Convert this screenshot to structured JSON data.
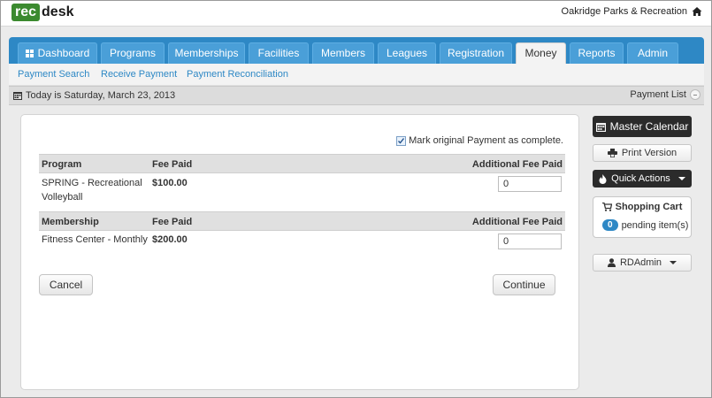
{
  "header": {
    "logo_left": "rec",
    "logo_right": "desk",
    "org_name": "Oakridge Parks & Recreation"
  },
  "nav": {
    "tabs": [
      "Dashboard",
      "Programs",
      "Memberships",
      "Facilities",
      "Members",
      "Leagues",
      "Registration",
      "Money",
      "Reports",
      "Admin"
    ],
    "active": "Money"
  },
  "subnav": {
    "links": [
      "Payment Search",
      "Receive Payment",
      "Payment Reconciliation"
    ]
  },
  "datebar": {
    "today": "Today is Saturday, March 23, 2013",
    "payment_list": "Payment List"
  },
  "form": {
    "mark_complete_label": "Mark original Payment as complete.",
    "mark_complete_checked": true,
    "program_table": {
      "headers": [
        "Program",
        "Fee Paid",
        "Additional Fee Paid"
      ],
      "rows": [
        {
          "name_line1": "SPRING - Recreational",
          "name_line2": "Volleyball",
          "fee": "$100.00",
          "additional": "0"
        }
      ]
    },
    "membership_table": {
      "headers": [
        "Membership",
        "Fee Paid",
        "Additional Fee Paid"
      ],
      "rows": [
        {
          "name": "Fitness Center - Monthly",
          "fee": "$200.00",
          "additional": "0"
        }
      ]
    },
    "cancel_label": "Cancel",
    "continue_label": "Continue"
  },
  "sidebar": {
    "master_calendar": "Master Calendar",
    "print_version": "Print Version",
    "quick_actions": "Quick Actions",
    "cart_title": "Shopping Cart",
    "cart_count": "0",
    "cart_pending": "pending item(s)",
    "user": "RDAdmin"
  },
  "colors": {
    "brand_green": "#3b8a2f",
    "nav_blue": "#2e88c5",
    "dark_button": "#2b2b2b"
  }
}
